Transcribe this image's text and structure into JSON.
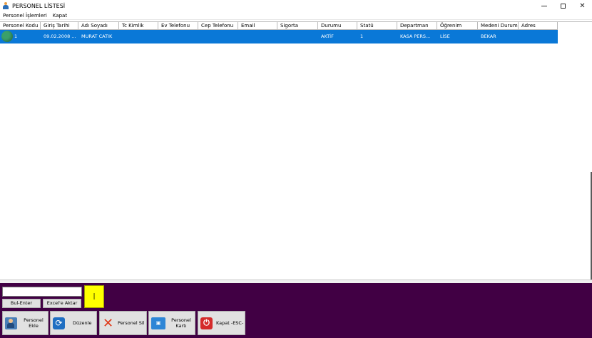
{
  "window": {
    "title": "PERSONEL LİSTESİ",
    "controls": {
      "minimize": "–",
      "maximize": "□",
      "close": "✕"
    }
  },
  "menu": {
    "items": [
      "Personel İşlemleri",
      "Kapat"
    ]
  },
  "grid": {
    "columns": [
      "Personel Kodu",
      "Giriş Tarihi",
      "Adı Soyadı",
      "Tc Kimlik",
      "Ev Telefonu",
      "Cep Telefonu",
      "Email",
      "Sigorta",
      "Durumu",
      "Statü",
      "Departman",
      "Öğrenim",
      "Medeni Durum",
      "Adres"
    ],
    "rows": [
      [
        "1",
        "09.02.2008 ...",
        "MURAT CATIK",
        "",
        "",
        "",
        "",
        "",
        "AKTİF",
        "1",
        "KASA PERS...",
        "LİSE",
        "BEKAR",
        ""
      ]
    ],
    "selected_row_color": "#0a78d7"
  },
  "panel": {
    "background": "#410044",
    "search": {
      "value": "",
      "placeholder": ""
    },
    "find_button": "Bul-Enter",
    "export_button": "Excel'e Aktar",
    "marker_text": "|",
    "actions": [
      {
        "label": "Personel Ekle",
        "icon": "user-add-icon"
      },
      {
        "label": "Düzenle",
        "icon": "edit-icon"
      },
      {
        "label": "Personel Sil",
        "icon": "delete-icon"
      },
      {
        "label": "Personel Kartı",
        "icon": "id-card-icon"
      },
      {
        "label": "Kapat -ESC-",
        "icon": "power-icon"
      }
    ]
  }
}
